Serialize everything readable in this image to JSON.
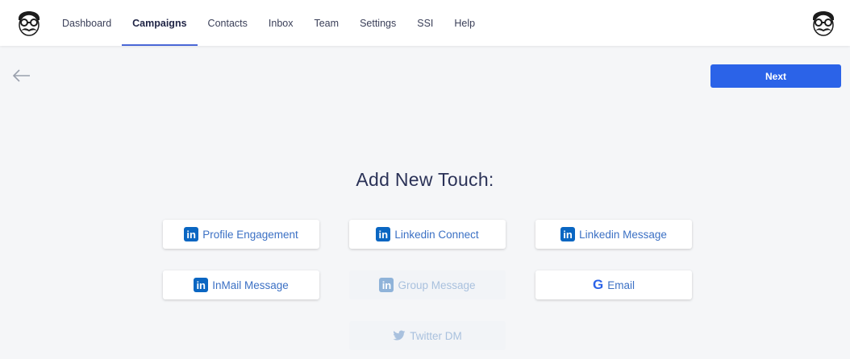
{
  "nav": {
    "items": [
      {
        "label": "Dashboard",
        "active": false
      },
      {
        "label": "Campaigns",
        "active": true
      },
      {
        "label": "Contacts",
        "active": false
      },
      {
        "label": "Inbox",
        "active": false
      },
      {
        "label": "Team",
        "active": false
      },
      {
        "label": "Settings",
        "active": false
      },
      {
        "label": "SSI",
        "active": false
      },
      {
        "label": "Help",
        "active": false
      }
    ]
  },
  "icons": {
    "logo": "mustache-glasses-avatar-icon",
    "back": "arrow-left-icon",
    "linkedin": "linkedin-icon",
    "google": "google-icon",
    "twitter": "twitter-icon"
  },
  "toolbar": {
    "next_label": "Next"
  },
  "page": {
    "heading": "Add New Touch:"
  },
  "touches": {
    "profile": {
      "label": "Profile Engagement",
      "icon_text": "in",
      "enabled": true
    },
    "connect": {
      "label": "Linkedin Connect",
      "icon_text": "in",
      "enabled": true
    },
    "liMessage": {
      "label": "Linkedin Message",
      "icon_text": "in",
      "enabled": true
    },
    "inmail": {
      "label": "InMail Message",
      "icon_text": "in",
      "enabled": true
    },
    "group": {
      "label": "Group Message",
      "icon_text": "in",
      "enabled": false
    },
    "email": {
      "label": "Email",
      "icon_text": "G",
      "enabled": true
    },
    "twitter": {
      "label": "Twitter DM",
      "enabled": false
    }
  },
  "colors": {
    "primary": "#2b63e8",
    "linkedin": "#0a66c2",
    "heading": "#2b3257",
    "button_text": "#3b70c4",
    "disabled_text": "#a9c1de"
  }
}
